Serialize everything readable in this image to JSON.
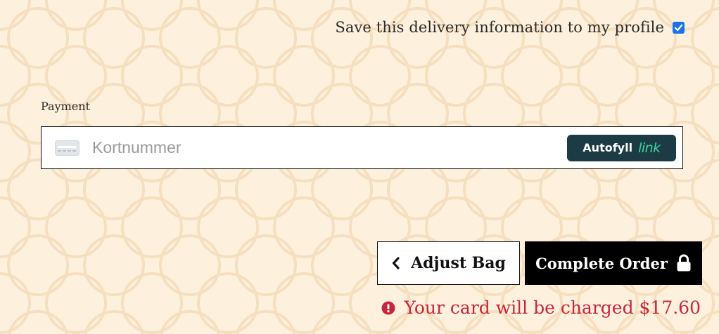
{
  "delivery": {
    "save_label": "Save this delivery information to my profile",
    "save_checked": true
  },
  "payment": {
    "section_label": "Payment",
    "card_placeholder": "Kortnummer",
    "card_icon": "credit-card-icon",
    "autofill_label": "Autofyll",
    "autofill_brand": "link"
  },
  "actions": {
    "adjust_label": "Adjust Bag",
    "adjust_icon": "chevron-left-icon",
    "complete_label": "Complete Order",
    "complete_icon": "lock-icon"
  },
  "notice": {
    "icon": "alert-circle-icon",
    "text": "Your card will be charged $17.60",
    "color": "#c5273d"
  },
  "colors": {
    "background": "#fdf0dc",
    "pattern": "#f6dfbf",
    "autofill_bg": "#1d3b45",
    "link_green": "#33d9a0",
    "checkbox_blue": "#1a73e8"
  }
}
